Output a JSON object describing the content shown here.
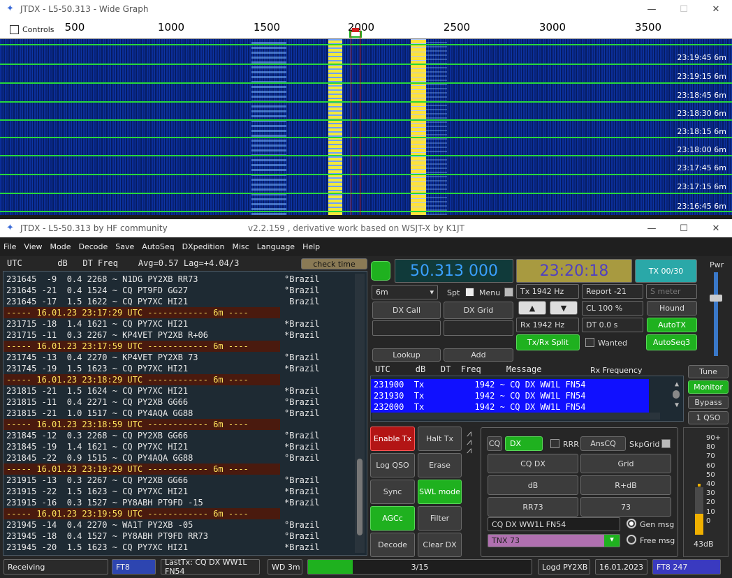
{
  "wide_graph": {
    "title": "JTDX - L5-50.313 - Wide Graph",
    "controls_label": "Controls",
    "ticks": [
      "500",
      "1000",
      "1500",
      "2000",
      "2500",
      "3000",
      "3500"
    ],
    "timestamps": [
      "23:19:45  6m",
      "23:19:15  6m",
      "23:18:45  6m",
      "23:18:30  6m",
      "23:18:15  6m",
      "23:18:00  6m",
      "23:17:45  6m",
      "23:17:15  6m",
      "23:16:45  6m"
    ]
  },
  "main": {
    "title": "JTDX - L5-50.313  by HF community",
    "title_center": "v2.2.159 , derivative work based on WSJT-X by K1JT",
    "menu": [
      "File",
      "View",
      "Mode",
      "Decode",
      "Save",
      "AutoSeq",
      "DXpedition",
      "Misc",
      "Language",
      "Help"
    ],
    "band_header": "UTC       dB   DT Freq    Avg=0.57 Lag=+4.04/3",
    "check_time": "check time",
    "band_lines": [
      {
        "t": "231645  -9  0.4 2268 ~ N1DG PY2XB RR73",
        "c": "°Brazil"
      },
      {
        "t": "231645 -21  0.4 1524 ~ CQ PT9FD GG27",
        "c": "°Brazil"
      },
      {
        "t": "231645 -17  1.5 1622 ~ CQ PY7XC HI21",
        "c": " Brazil"
      },
      {
        "t": "----- 16.01.23 23:17:29 UTC ------------ 6m ----",
        "sep": true
      },
      {
        "t": "231715 -18  1.4 1621 ~ CQ PY7XC HI21",
        "c": "*Brazil"
      },
      {
        "t": "231715 -11  0.3 2267 ~ KP4VET PY2XB R+06",
        "c": "*Brazil"
      },
      {
        "t": "----- 16.01.23 23:17:59 UTC ------------ 6m ----",
        "sep": true
      },
      {
        "t": "231745 -13  0.4 2270 ~ KP4VET PY2XB 73",
        "c": "°Brazil"
      },
      {
        "t": "231745 -19  1.5 1623 ~ CQ PY7XC HI21",
        "c": "*Brazil"
      },
      {
        "t": "----- 16.01.23 23:18:29 UTC ------------ 6m ----",
        "sep": true
      },
      {
        "t": "231815 -21  1.5 1624 ~ CQ PY7XC HI21",
        "c": "*Brazil"
      },
      {
        "t": "231815 -11  0.4 2271 ~ CQ PY2XB GG66",
        "c": "°Brazil"
      },
      {
        "t": "231815 -21  1.0 1517 ~ CQ PY4AQA GG88",
        "c": "°Brazil"
      },
      {
        "t": "----- 16.01.23 23:18:59 UTC ------------ 6m ----",
        "sep": true
      },
      {
        "t": "231845 -12  0.3 2268 ~ CQ PY2XB GG66",
        "c": "°Brazil"
      },
      {
        "t": "231845 -19  1.4 1621 ~ CQ PY7XC HI21",
        "c": "*Brazil"
      },
      {
        "t": "231845 -22  0.9 1515 ~ CQ PY4AQA GG88",
        "c": "°Brazil"
      },
      {
        "t": "----- 16.01.23 23:19:29 UTC ------------ 6m ----",
        "sep": true
      },
      {
        "t": "231915 -13  0.3 2267 ~ CQ PY2XB GG66",
        "c": "°Brazil"
      },
      {
        "t": "231915 -22  1.5 1623 ~ CQ PY7XC HI21",
        "c": "*Brazil"
      },
      {
        "t": "231915 -16  0.3 1527 ~ PY8ABH PT9FD -15",
        "c": "*Brazil"
      },
      {
        "t": "----- 16.01.23 23:19:59 UTC ------------ 6m ----",
        "sep": true
      },
      {
        "t": "231945 -14  0.4 2270 ~ WA1T PY2XB -05",
        "c": "°Brazil"
      },
      {
        "t": "231945 -18  0.4 1527 ~ PY8ABH PT9FD RR73",
        "c": "°Brazil"
      },
      {
        "t": "231945 -20  1.5 1623 ~ CQ PY7XC HI21",
        "c": "*Brazil"
      }
    ],
    "freq": "50.313 000",
    "clock": "23:20:18",
    "tx_count": "TX 00/30",
    "pwr": "Pwr",
    "band": "6m",
    "spt": "Spt",
    "menu_lbl": "Menu",
    "tx_hz": "Tx  1942  Hz",
    "report": "Report -21",
    "smeter": "S meter",
    "dx_call": "DX Call",
    "dx_grid": "DX Grid",
    "up": "▲",
    "down": "▼",
    "cl": "CL  100 %",
    "hound": "Hound",
    "rx_hz": "Rx  1942  Hz",
    "dt": "DT 0.0 s",
    "autotx": "AutoTX",
    "split": "Tx/Rx Split",
    "wanted": "Wanted",
    "autoseq3": "AutoSeq3",
    "lookup": "Lookup",
    "add": "Add",
    "rx_header": "UTC     dB   DT  Freq     Message",
    "rx_freq_label": "Rx Frequency",
    "rx_lines": [
      "231900  Tx          1942 ~ CQ DX WW1L FN54",
      "231930  Tx          1942 ~ CQ DX WW1L FN54",
      "232000  Tx          1942 ~ CQ DX WW1L FN54"
    ],
    "tune": "Tune",
    "monitor": "Monitor",
    "bypass": "Bypass",
    "qso1": "1 QSO",
    "enable_tx": "Enable Tx",
    "halt_tx": "Halt Tx",
    "log_qso": "Log QSO",
    "erase": "Erase",
    "sync": "Sync",
    "swl": "SWL mode",
    "agcc": "AGCc",
    "filter": "Filter",
    "decode": "Decode",
    "clear_dx": "Clear DX",
    "cq": "CQ",
    "dx": "DX",
    "rrr": "RRR",
    "anscq": "AnsCQ",
    "skpgrid": "SkpGrid",
    "cq_dx": "CQ DX",
    "grid": "Grid",
    "db": "dB",
    "rdb": "R+dB",
    "rr73": "RR73",
    "s73": "73",
    "msg": "CQ DX WW1L FN54",
    "gen_msg": "Gen msg",
    "tnx": "TNX 73",
    "free_msg": "Free msg",
    "meter": [
      "90+",
      "80",
      "70",
      "60",
      "50",
      "40",
      "30",
      "20",
      "10",
      "0"
    ],
    "meter_db": "43dB",
    "meter_level": 0.43,
    "status": {
      "receiving": "Receiving",
      "mode": "FT8",
      "lasttx": "LastTx: CQ DX WW1L FN54",
      "wd": "WD 3m",
      "progress": "3/15",
      "progress_frac": 0.2,
      "logd": "Logd PY2XB",
      "date": "16.01.2023",
      "ft8": "FT8  247"
    }
  }
}
